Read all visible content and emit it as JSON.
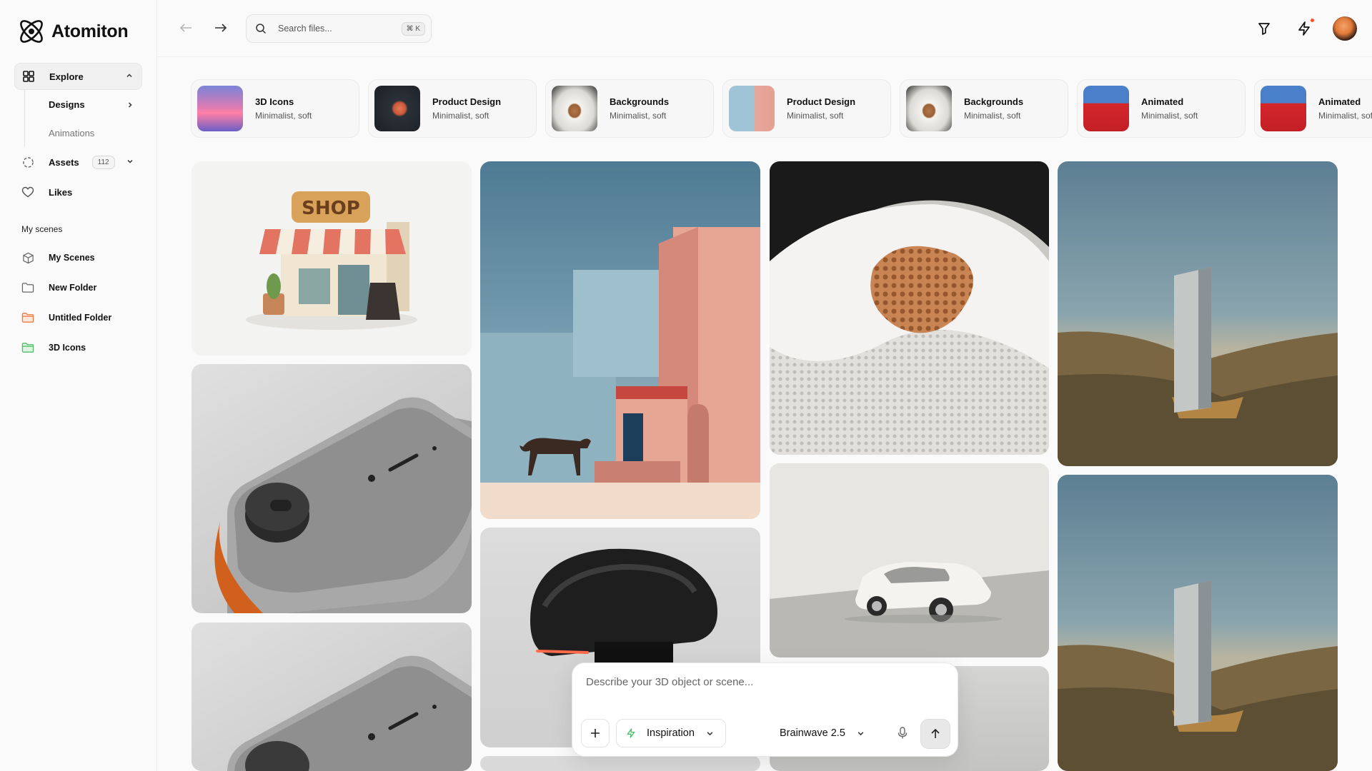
{
  "app": {
    "name": "Atomiton"
  },
  "sidebar": {
    "explore": {
      "label": "Explore"
    },
    "sub_items": [
      {
        "label": "Designs"
      },
      {
        "label": "Animations"
      }
    ],
    "assets": {
      "label": "Assets",
      "count": "112"
    },
    "likes": {
      "label": "Likes"
    },
    "my_scenes_title": "My scenes",
    "scenes": [
      {
        "label": "My Scenes",
        "icon": "cube-icon",
        "color": "#666666"
      },
      {
        "label": "New Folder",
        "icon": "folder-outline-icon",
        "color": "#666666"
      },
      {
        "label": "Untitled Folder",
        "icon": "folder-icon",
        "color": "#f07a45"
      },
      {
        "label": "3D Icons",
        "icon": "folder-icon",
        "color": "#4cbf6a"
      }
    ]
  },
  "header": {
    "search_placeholder": "Search files...",
    "search_shortcut": "⌘ K"
  },
  "categories": [
    {
      "title": "3D Icons",
      "subtitle": "Minimalist, soft"
    },
    {
      "title": "Product Design",
      "subtitle": "Minimalist, soft"
    },
    {
      "title": "Backgrounds",
      "subtitle": "Minimalist, soft"
    },
    {
      "title": "Product Design",
      "subtitle": "Minimalist, soft"
    },
    {
      "title": "Backgrounds",
      "subtitle": "Minimalist, soft"
    },
    {
      "title": "Animated",
      "subtitle": "Minimalist, soft"
    },
    {
      "title": "Animated",
      "subtitle": "Minimalist, soft"
    }
  ],
  "gallery": {
    "shop_sign": "SHOP"
  },
  "prompt": {
    "placeholder": "Describe your 3D object or scene...",
    "inspiration_label": "Inspiration",
    "model_label": "Brainwave 2.5"
  },
  "colors": {
    "accent_green": "#4cbf6a",
    "accent_orange": "#f07a45",
    "notification": "#ff4a2b"
  }
}
